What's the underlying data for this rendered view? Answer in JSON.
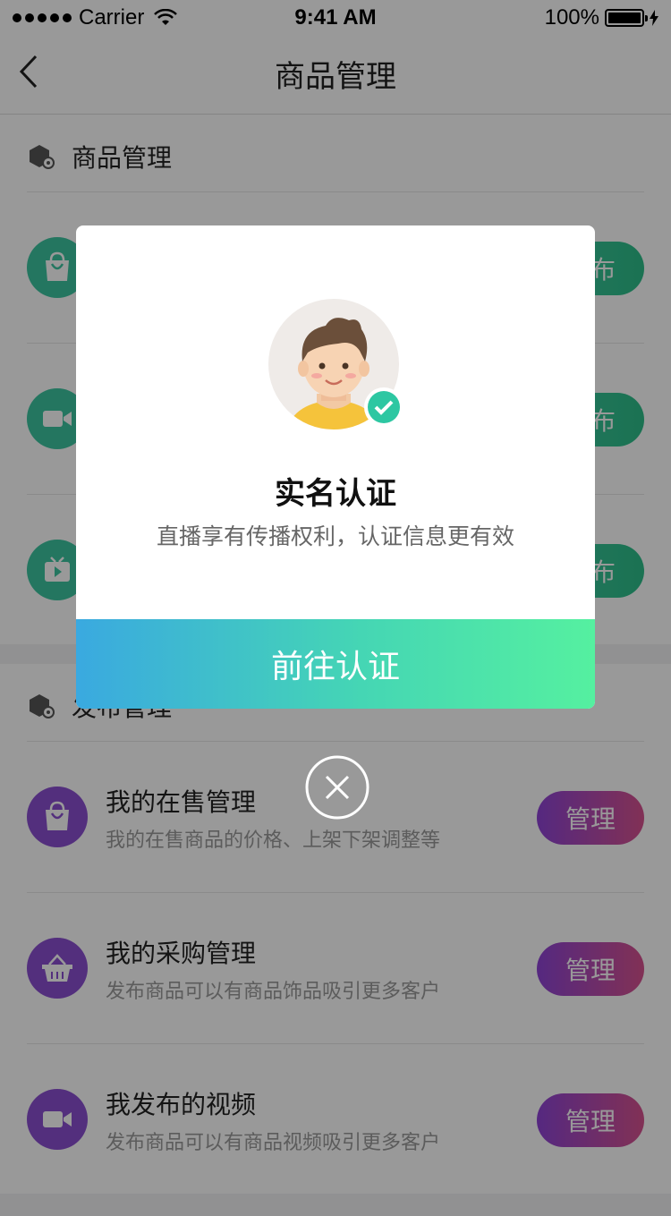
{
  "status_bar": {
    "carrier": "Carrier",
    "time": "9:41 AM",
    "battery": "100%"
  },
  "nav": {
    "title": "商品管理"
  },
  "section1": {
    "title": "商品管理",
    "rows": [
      {
        "icon": "shopping-bag-icon",
        "button": "发布"
      },
      {
        "icon": "video-camera-icon",
        "button": "发布"
      },
      {
        "icon": "tv-play-icon",
        "button": "发布"
      }
    ]
  },
  "section2": {
    "title": "发布管理",
    "rows": [
      {
        "title": "我的在售管理",
        "desc": "我的在售商品的价格、上架下架调整等",
        "button": "管理",
        "icon": "shopping-bag-icon"
      },
      {
        "title": "我的采购管理",
        "desc": "发布商品可以有商品饰品吸引更多客户",
        "button": "管理",
        "icon": "basket-icon"
      },
      {
        "title": "我发布的视频",
        "desc": "发布商品可以有商品视频吸引更多客户",
        "button": "管理",
        "icon": "video-camera-icon"
      }
    ]
  },
  "modal": {
    "title": "实名认证",
    "desc": "直播享有传播权利，认证信息更有效",
    "button": "前往认证"
  },
  "colors": {
    "green": "#3cc5a1",
    "purple": "#8a4fd1",
    "pink": "#d8528f",
    "gradient_start": "#3aa9e0",
    "gradient_end": "#55f0a0"
  }
}
